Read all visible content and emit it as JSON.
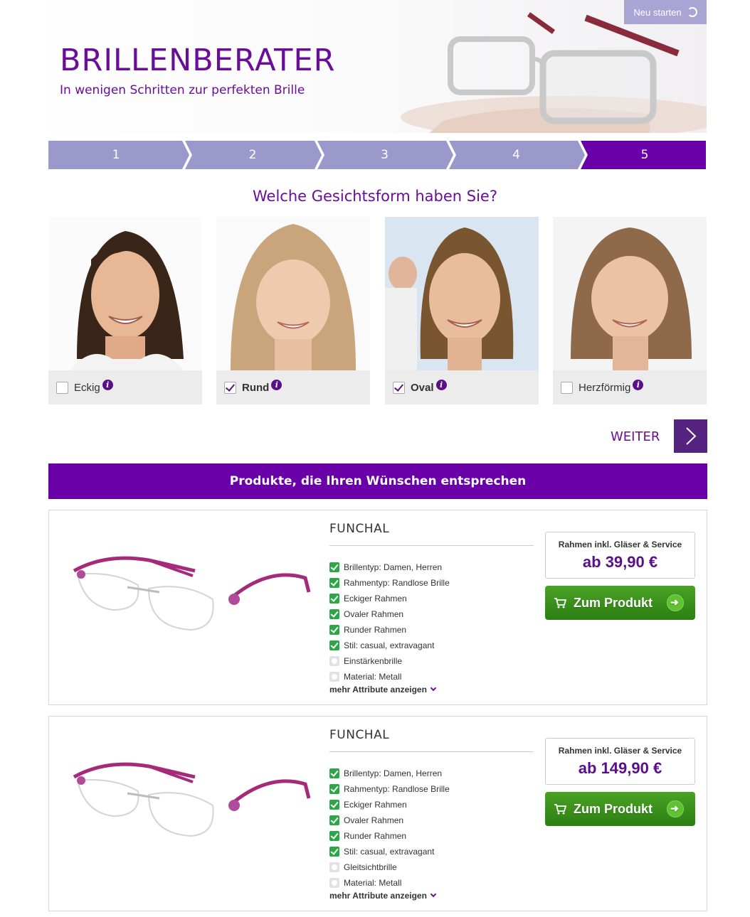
{
  "header": {
    "title": "BRILLENBERATER",
    "subtitle": "In wenigen Schritten zur perfekten Brille",
    "restart_label": "Neu starten"
  },
  "steps": [
    "1",
    "2",
    "3",
    "4",
    "5"
  ],
  "question": "Welche Gesichtsform haben Sie?",
  "face_options": [
    {
      "label": "Eckig",
      "checked": false
    },
    {
      "label": "Rund",
      "checked": true
    },
    {
      "label": "Oval",
      "checked": true
    },
    {
      "label": "Herzförmig",
      "checked": false
    }
  ],
  "weiter_label": "WEITER",
  "products_banner": "Produkte, die Ihren Wünschen entsprechen",
  "products": [
    {
      "name": "FUNCHAL",
      "price_label": "Rahmen inkl. Gläser & Service",
      "price": "ab 39,90 €",
      "button_label": "Zum Produkt",
      "more_label": "mehr Attribute anzeigen",
      "attributes": [
        {
          "text": "Brillentyp: Damen, Herren",
          "match": true
        },
        {
          "text": "Rahmentyp: Randlose Brille",
          "match": true
        },
        {
          "text": "Eckiger Rahmen",
          "match": true
        },
        {
          "text": "Ovaler Rahmen",
          "match": true
        },
        {
          "text": "Runder Rahmen",
          "match": true
        },
        {
          "text": "Stil: casual, extravagant",
          "match": true
        },
        {
          "text": "Einstärkenbrille",
          "match": false
        },
        {
          "text": "Material: Metall",
          "match": false
        }
      ]
    },
    {
      "name": "FUNCHAL",
      "price_label": "Rahmen inkl. Gläser & Service",
      "price": "ab 149,90 €",
      "button_label": "Zum Produkt",
      "more_label": "mehr Attribute anzeigen",
      "attributes": [
        {
          "text": "Brillentyp: Damen, Herren",
          "match": true
        },
        {
          "text": "Rahmentyp: Randlose Brille",
          "match": true
        },
        {
          "text": "Eckiger Rahmen",
          "match": true
        },
        {
          "text": "Ovaler Rahmen",
          "match": true
        },
        {
          "text": "Runder Rahmen",
          "match": true
        },
        {
          "text": "Stil: casual, extravagant",
          "match": true
        },
        {
          "text": "Gleitsichtbrille",
          "match": false
        },
        {
          "text": "Material: Metall",
          "match": false
        }
      ]
    }
  ],
  "colors": {
    "brand": "#6a0d9a",
    "step_inactive": "#9b99cc",
    "step_active": "#6a00a8",
    "buy_button": "#2c7f12"
  }
}
